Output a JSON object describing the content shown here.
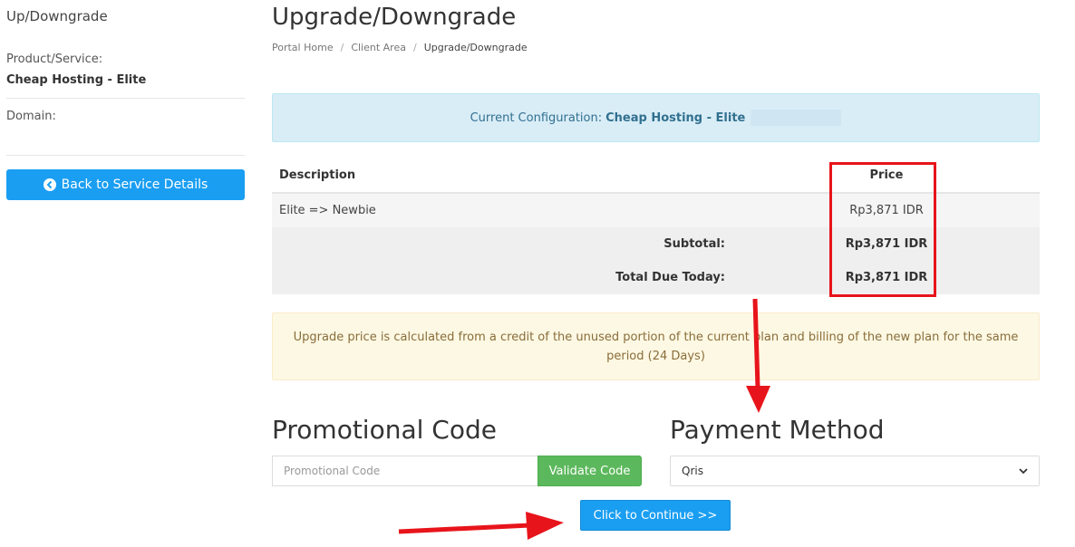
{
  "sidebar": {
    "title": "Up/Downgrade",
    "product_label": "Product/Service:",
    "product_value": "Cheap Hosting - Elite",
    "domain_label": "Domain:",
    "back_button": "Back to Service Details"
  },
  "main": {
    "title": "Upgrade/Downgrade",
    "breadcrumb": [
      "Portal Home",
      "Client Area",
      "Upgrade/Downgrade"
    ],
    "config": {
      "label": "Current Configuration:",
      "value": "Cheap Hosting - Elite"
    },
    "table": {
      "headers": {
        "description": "Description",
        "price": "Price"
      },
      "rows": [
        {
          "description": "Elite => Newbie",
          "price": "Rp3,871 IDR"
        }
      ],
      "subtotal_label": "Subtotal:",
      "subtotal_value": "Rp3,871 IDR",
      "total_label": "Total Due Today:",
      "total_value": "Rp3,871 IDR"
    },
    "notice": "Upgrade price is calculated from a credit of the unused portion of the current plan and billing of the new plan for the same period (24 Days)",
    "promo": {
      "title": "Promotional Code",
      "placeholder": "Promotional Code",
      "validate_button": "Validate Code"
    },
    "payment": {
      "title": "Payment Method",
      "selected": "Qris"
    },
    "continue_button": "Click to Continue >>"
  },
  "colors": {
    "primary_button": "#1a9ef2",
    "success_button": "#5cb85c",
    "annotation_red": "#e8141b"
  }
}
